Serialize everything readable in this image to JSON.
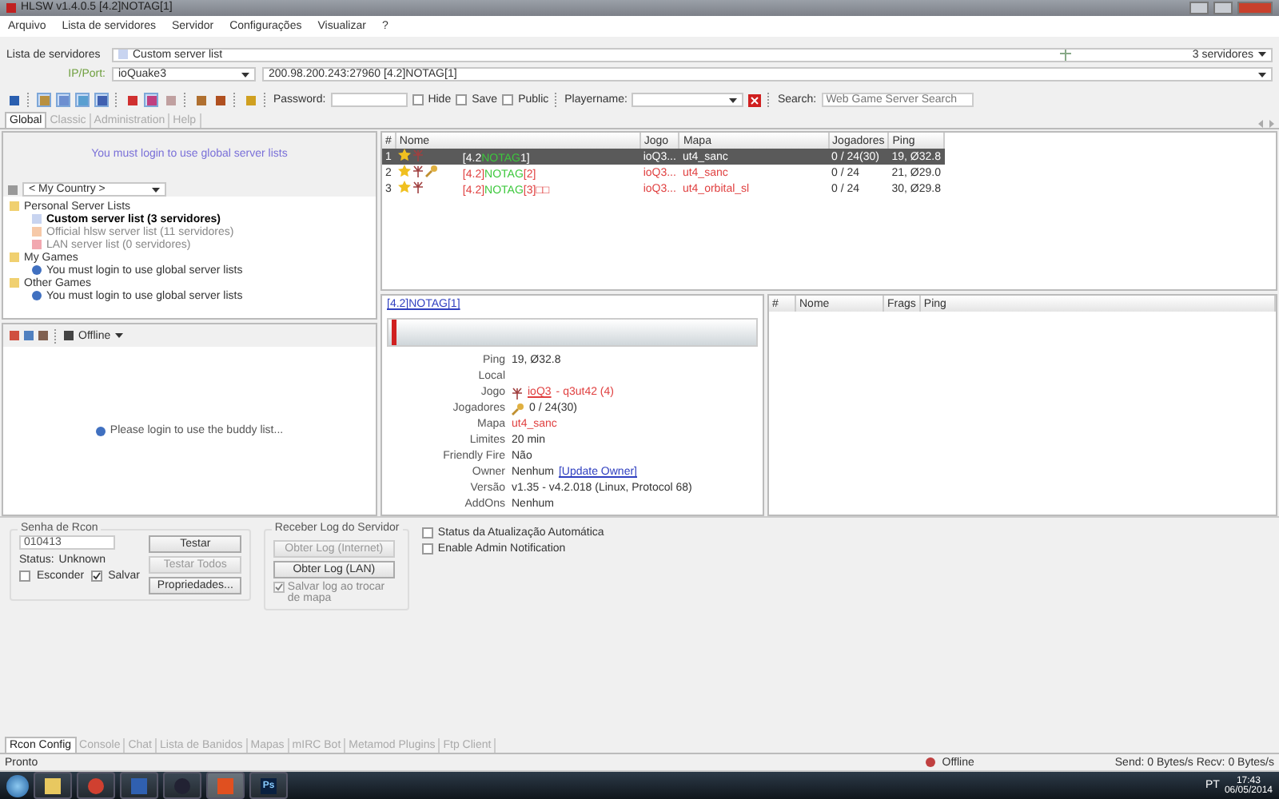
{
  "window": {
    "title": "HLSW v1.4.0.5   [4.2]NOTAG[1]"
  },
  "menu": [
    "Arquivo",
    "Lista de servidores",
    "Servidor",
    "Configurações",
    "Visualizar",
    "?"
  ],
  "server_list_row": {
    "label": "Lista de servidores",
    "value": "Custom server list",
    "count": "3 servidores"
  },
  "ip_row": {
    "label": "IP/Port:",
    "game": "ioQuake3",
    "address": "200.98.200.243:27960 [4.2]NOTAG[1]"
  },
  "toolbar": {
    "tools": [
      {
        "pressed": false
      },
      {
        "pressed": true
      },
      {
        "pressed": true
      },
      {
        "pressed": true
      },
      {
        "pressed": true
      },
      {
        "pressed": false
      },
      {
        "pressed": true
      },
      {
        "pressed": false
      },
      {
        "pressed": false
      },
      {
        "pressed": false
      },
      {
        "pressed": false
      }
    ],
    "password_label": "Password:",
    "hide": {
      "label": "Hide",
      "checked": false
    },
    "save": {
      "label": "Save",
      "checked": false
    },
    "public": {
      "label": "Public",
      "checked": false
    },
    "playername_label": "Playername:",
    "search_label": "Search:",
    "search_placeholder": "Web Game Server Search"
  },
  "tabs": [
    {
      "label": "Global",
      "selected": true
    },
    {
      "label": "Classic",
      "selected": false
    },
    {
      "label": "Administration",
      "selected": false
    },
    {
      "label": "Help",
      "selected": false
    }
  ],
  "left_panel": {
    "login_message": "You must login to use global server lists",
    "country": "< My Country >",
    "tree": [
      {
        "label": "Personal Server Lists",
        "kind": "folder",
        "children": [
          {
            "label": "Custom server list (3 servidores)",
            "kind": "list",
            "color": "#c8d4f0",
            "selected": true
          },
          {
            "label": "Official hlsw server list (11 servidores)",
            "kind": "list",
            "color": "#f6c9a8",
            "selected": false
          },
          {
            "label": "LAN server list (0 servidores)",
            "kind": "list",
            "color": "#f2a8b0",
            "selected": false
          }
        ]
      },
      {
        "label": "My Games",
        "kind": "folder",
        "children": [
          {
            "label": "You must login to use global server lists",
            "kind": "info"
          }
        ]
      },
      {
        "label": "Other Games",
        "kind": "folder",
        "children": [
          {
            "label": "You must login to use global server lists",
            "kind": "info"
          }
        ]
      }
    ]
  },
  "buddy": {
    "status": "Offline",
    "message": "Please login to use the buddy list..."
  },
  "servers": {
    "columns": [
      "#",
      "Nome",
      "Jogo",
      "Mapa",
      "Jogadores",
      "Ping"
    ],
    "rows": [
      {
        "index": "1",
        "favorite": true,
        "password": false,
        "name": [
          {
            "text": "[4.2",
            "kind": "plain"
          },
          {
            "text": "NOTAG",
            "kind": "tag"
          },
          {
            "text": "1]",
            "kind": "plain"
          }
        ],
        "game": "ioQ3...",
        "map": "ut4_sanc",
        "players": "0 / 24(30)",
        "ping": "19, Ø32.8",
        "selected": true
      },
      {
        "index": "2",
        "favorite": true,
        "password": true,
        "name": [
          {
            "text": "[4.2]",
            "kind": "plain"
          },
          {
            "text": "NOTAG",
            "kind": "tag"
          },
          {
            "text": "[2]",
            "kind": "plain"
          }
        ],
        "game": "ioQ3...",
        "map": "ut4_sanc",
        "players": "0 / 24",
        "ping": "21, Ø29.0",
        "selected": false
      },
      {
        "index": "3",
        "favorite": true,
        "password": false,
        "name": [
          {
            "text": "[4.2]",
            "kind": "plain"
          },
          {
            "text": "NOTAG",
            "kind": "tag"
          },
          {
            "text": "[3]□□",
            "kind": "plain"
          }
        ],
        "game": "ioQ3...",
        "map": "ut4_orbital_sl",
        "players": "0 / 24",
        "ping": "30, Ø29.8",
        "selected": false
      }
    ]
  },
  "details": {
    "title": "[4.2]NOTAG[1]",
    "fields": [
      {
        "label": "Ping",
        "parts": [
          {
            "text": "19, Ø32.8",
            "kind": "plain"
          }
        ]
      },
      {
        "label": "Local",
        "kind": "plain"
      },
      {
        "label": "Jogo",
        "kind": "game",
        "parts": [
          {
            "text": "ioQ3",
            "kind": "red-link"
          },
          {
            "text": "- q3ut42 (4)",
            "kind": "red"
          }
        ]
      },
      {
        "label": "Jogadores",
        "kind": "players",
        "parts": [
          {
            "text": "0 / 24(30)",
            "kind": "plain"
          }
        ]
      },
      {
        "label": "Mapa",
        "parts": [
          {
            "text": "ut4_sanc",
            "kind": "red"
          }
        ]
      },
      {
        "label": "Limites",
        "parts": [
          {
            "text": "20 min",
            "kind": "plain"
          }
        ]
      },
      {
        "label": "Friendly Fire",
        "parts": [
          {
            "text": "Não",
            "kind": "plain"
          }
        ]
      },
      {
        "label": "Owner",
        "parts": [
          {
            "text": "Nenhum",
            "kind": "plain"
          },
          {
            "text": "[Update Owner]",
            "kind": "link"
          }
        ]
      },
      {
        "label": "Versão",
        "parts": [
          {
            "text": "v1.35 - v4.2.018 (Linux, Protocol 68)",
            "kind": "plain"
          }
        ]
      },
      {
        "label": "AddOns",
        "parts": [
          {
            "text": "Nenhum",
            "kind": "plain"
          }
        ]
      }
    ]
  },
  "players": {
    "columns": [
      "#",
      "Nome",
      "Frags",
      "Ping"
    ]
  },
  "rcon": {
    "title": "Senha de Rcon",
    "password": "010413",
    "status_label": "Status:",
    "status": "Unknown",
    "buttons": [
      {
        "label": "Testar",
        "disabled": false
      },
      {
        "label": "Testar Todos",
        "disabled": true
      },
      {
        "label": "Propriedades...",
        "disabled": false
      }
    ],
    "checks": [
      {
        "label": "Esconder",
        "checked": false
      },
      {
        "label": "Salvar",
        "checked": true
      }
    ]
  },
  "log": {
    "title": "Receber Log do Servidor",
    "buttons": [
      {
        "label": "Obter Log (Internet)",
        "disabled": true
      },
      {
        "label": "Obter Log (LAN)",
        "disabled": false
      }
    ],
    "check": {
      "label": "Salvar log ao trocar de mapa",
      "checked": true,
      "disabled": true
    }
  },
  "options": [
    {
      "label": "Status da Atualização Automática",
      "checked": false
    },
    {
      "label": "Enable Admin Notification",
      "checked": false
    }
  ],
  "bottom_tabs": [
    {
      "label": "Rcon Config",
      "selected": true
    },
    {
      "label": "Console",
      "selected": false
    },
    {
      "label": "Chat",
      "selected": false
    },
    {
      "label": "Lista de Banidos",
      "selected": false
    },
    {
      "label": "Mapas",
      "selected": false
    },
    {
      "label": "mIRC Bot",
      "selected": false
    },
    {
      "label": "Metamod Plugins",
      "selected": false
    },
    {
      "label": "Ftp Client",
      "selected": false
    }
  ],
  "status_bar": {
    "text": "Pronto",
    "connection": "Offline",
    "traffic": "Send: 0 Bytes/s  Recv: 0 Bytes/s"
  },
  "taskbar": {
    "apps": [
      {
        "kind": "folder",
        "active": false
      },
      {
        "kind": "browser",
        "active": false
      },
      {
        "kind": "document",
        "active": false
      },
      {
        "kind": "steam",
        "active": false
      },
      {
        "kind": "hlsw",
        "active": true
      },
      {
        "kind": "photoshop",
        "active": false,
        "label": "Ps"
      }
    ],
    "language": "PT",
    "time": "17:43",
    "date": "06/05/2014"
  }
}
